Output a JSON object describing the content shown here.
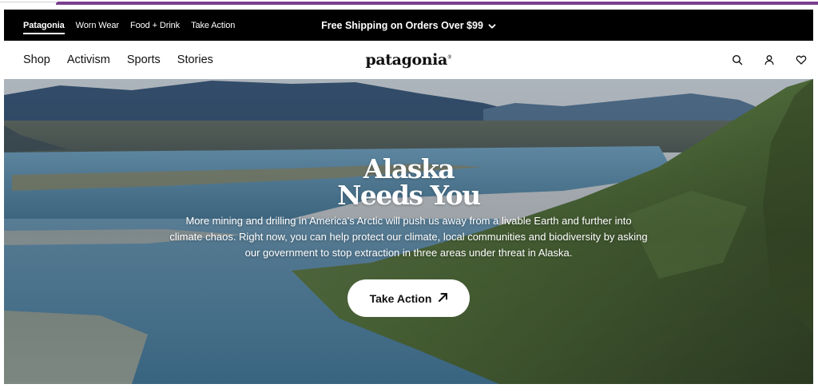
{
  "promo_bar": {
    "brand_links": [
      {
        "label": "Patagonia",
        "active": true
      },
      {
        "label": "Worn Wear",
        "active": false
      },
      {
        "label": "Food + Drink",
        "active": false
      },
      {
        "label": "Take Action",
        "active": false
      }
    ],
    "announcement": "Free Shipping on Orders Over $99",
    "announcement_icon": "chevron-down-icon"
  },
  "nav": {
    "items": [
      "Shop",
      "Activism",
      "Sports",
      "Stories"
    ],
    "logo": "patagonia",
    "logo_mark": "®",
    "icons": [
      "search-icon",
      "account-icon",
      "heart-icon"
    ]
  },
  "hero": {
    "title_line1": "Alaska",
    "title_line2": "Needs You",
    "body": "More mining and drilling in America's Arctic will push us away from a livable Earth and further into climate chaos. Right now, you can help protect our climate, local communities and biodiversity by asking our government to stop extraction in three areas under threat in Alaska.",
    "cta_label": "Take Action",
    "cta_icon": "arrow-up-right-icon"
  },
  "colors": {
    "accent_bar": "#7b3f8f",
    "promo_bg": "#000000",
    "text": "#111111"
  }
}
